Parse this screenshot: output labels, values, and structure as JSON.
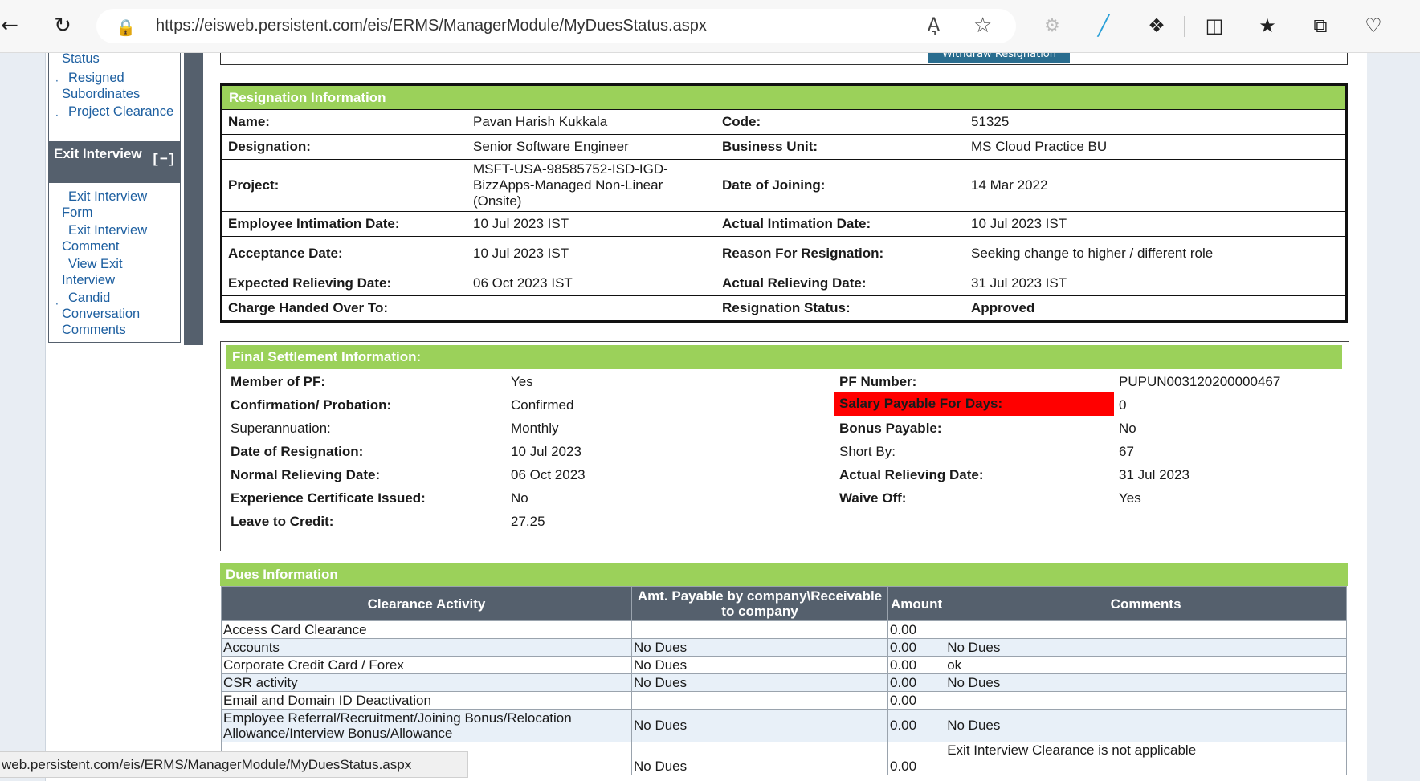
{
  "browser": {
    "url": "https://eisweb.persistent.com/eis/ERMS/ManagerModule/MyDuesStatus.aspx",
    "read_aloud_label": "A͉",
    "icons": [
      "back-icon",
      "refresh-icon",
      "lock-icon",
      "read-aloud-icon",
      "favorite-star-icon",
      "extension-icon",
      "pen-icon",
      "puzzle-icon",
      "split-screen-icon",
      "favorites-icon",
      "collections-icon",
      "health-icon"
    ]
  },
  "sidebar": {
    "links": [
      {
        "label": "Status"
      },
      {
        "label": "Resigned Subordinates"
      },
      {
        "label": "Project Clearance"
      }
    ],
    "section": {
      "title": "Exit Interview",
      "toggle": "[−]"
    },
    "section_links": [
      {
        "label": "Exit Interview Form"
      },
      {
        "label": "Exit Interview Comment"
      },
      {
        "label": "View Exit Interview"
      },
      {
        "label": "Candid Conversation Comments"
      }
    ]
  },
  "withdraw_button": "Withdraw Resignation",
  "resignation": {
    "title": "Resignation Information",
    "rows": [
      {
        "l1": "Name:",
        "v1": "Pavan Harish Kukkala",
        "l2": "Code:",
        "v2": "51325"
      },
      {
        "l1": "Designation:",
        "v1": "Senior Software Engineer",
        "l2": "Business Unit:",
        "v2": "MS Cloud Practice BU"
      },
      {
        "l1": "Project:",
        "v1": "MSFT-USA-98585752-ISD-IGD-BizzApps-Managed Non-Linear (Onsite)",
        "l2": "Date of Joining:",
        "v2": "14 Mar 2022"
      },
      {
        "l1": "Employee Intimation Date:",
        "v1": "10 Jul 2023 IST",
        "l2": "Actual Intimation Date:",
        "v2": "10 Jul 2023 IST"
      },
      {
        "l1": "Acceptance Date:",
        "v1": "10 Jul 2023 IST",
        "l2": "Reason For Resignation:",
        "v2": "Seeking change to higher / different role"
      },
      {
        "l1": "Expected Relieving Date:",
        "v1": "06 Oct 2023 IST",
        "l2": "Actual Relieving Date:",
        "v2": "31 Jul 2023 IST"
      },
      {
        "l1": "Charge Handed Over To:",
        "v1": "",
        "l2": "Resignation Status:",
        "v2": "Approved"
      }
    ]
  },
  "final_settlement": {
    "title": "Final Settlement Information:",
    "rows": [
      {
        "l1": "Member of PF:",
        "v1": "Yes",
        "l2": "PF Number:",
        "v2": "PUPUN003120200000467"
      },
      {
        "l1": "Confirmation/ Probation:",
        "v1": "Confirmed",
        "l2": "Salary Payable For Days:",
        "v2": "0"
      },
      {
        "l1": "Superannuation:",
        "v1": "Monthly",
        "l2": "Bonus Payable:",
        "v2": "No"
      },
      {
        "l1": "Date of Resignation:",
        "v1": "10 Jul 2023",
        "l2": "Short By:",
        "v2": "67"
      },
      {
        "l1": "Normal Relieving Date:",
        "v1": "06 Oct 2023",
        "l2": "Actual Relieving Date:",
        "v2": "31 Jul 2023"
      },
      {
        "l1": "Experience Certificate Issued:",
        "v1": "No",
        "l2": "Waive Off:",
        "v2": "Yes"
      },
      {
        "l1": "Leave to Credit:",
        "v1": "27.25",
        "l2": "",
        "v2": ""
      }
    ],
    "highlight_color": "#ff0000"
  },
  "dues": {
    "title": "Dues Information",
    "columns": [
      "Clearance Activity",
      "Amt. Payable by company\\Receivable to company",
      "Amount",
      "Comments"
    ],
    "rows": [
      {
        "activity": "Access Card Clearance",
        "payable": "",
        "amount": "0.00",
        "comments": ""
      },
      {
        "activity": "Accounts",
        "payable": "No Dues",
        "amount": "0.00",
        "comments": "No Dues"
      },
      {
        "activity": "Corporate Credit Card / Forex",
        "payable": "No Dues",
        "amount": "0.00",
        "comments": "ok"
      },
      {
        "activity": "CSR activity",
        "payable": "No Dues",
        "amount": "0.00",
        "comments": "No Dues"
      },
      {
        "activity": "Email and Domain ID Deactivation",
        "payable": "",
        "amount": "0.00",
        "comments": ""
      },
      {
        "activity": "Employee Referral/Recruitment/Joining Bonus/Relocation Allowance/Interview Bonus/Allowance",
        "payable": "No Dues",
        "amount": "0.00",
        "comments": "No Dues"
      },
      {
        "activity": "",
        "payable": "No Dues",
        "amount": "0.00",
        "comments": "Exit Interview Clearance is not applicable"
      }
    ]
  },
  "status_bar": "web.persistent.com/eis/ERMS/ManagerModule/MyDuesStatus.aspx",
  "colors": {
    "accent_green": "#9bd15a",
    "header_slate": "#55606d",
    "link_blue": "#1d5fa0"
  }
}
